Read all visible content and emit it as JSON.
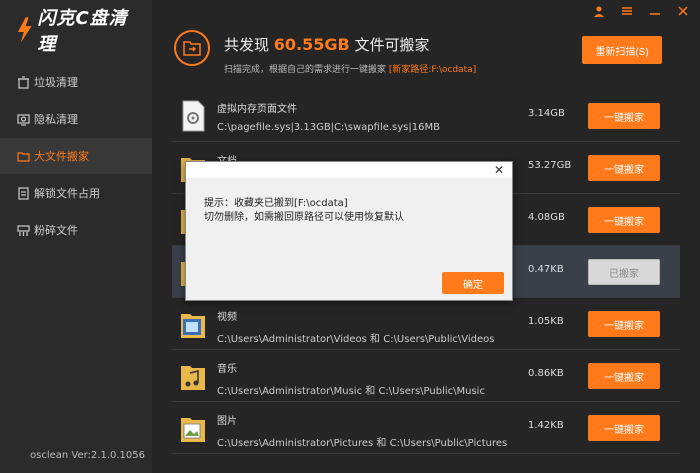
{
  "app": {
    "title": "闪克C盘清理",
    "version": "osclean Ver:2.1.0.1056"
  },
  "topbar": {
    "icons": [
      "user-icon",
      "menu-icon",
      "minimize-icon",
      "close-icon"
    ]
  },
  "sidebar": {
    "items": [
      {
        "label": "垃圾清理",
        "icon": "trash-icon"
      },
      {
        "label": "隐私清理",
        "icon": "privacy-icon"
      },
      {
        "label": "大文件搬家",
        "icon": "folder-icon",
        "active": true
      },
      {
        "label": "解锁文件占用",
        "icon": "unlock-icon"
      },
      {
        "label": "粉碎文件",
        "icon": "shred-icon"
      }
    ]
  },
  "header": {
    "title_prefix": "共发现 ",
    "title_size": "60.55GB",
    "title_suffix": " 文件可搬家",
    "subtitle": "扫描完成，根据自己的需求进行一键搬家 ",
    "new_path": "[新家路径:F:\\ocdata]",
    "rescan_label": "重新扫描(S)"
  },
  "rows": [
    {
      "name": "虚拟内存页面文件",
      "path": "C:\\pagefile.sys|3.13GB|C:\\swapfile.sys|16MB",
      "size": "3.14GB",
      "button": "一键搬家",
      "done": false,
      "icon": "gear-file-icon"
    },
    {
      "name": "文档",
      "path": "",
      "size": "53.27GB",
      "button": "一键搬家",
      "done": false,
      "icon": "documents-folder-icon"
    },
    {
      "name": "",
      "path": "",
      "size": "4.08GB",
      "button": "一键搬家",
      "done": false,
      "icon": "folder-icon"
    },
    {
      "name": "",
      "path": "",
      "size": "0.47KB",
      "button": "已搬家",
      "done": true,
      "icon": "folder-icon"
    },
    {
      "name": "视频",
      "path": "C:\\Users\\Administrator\\Videos 和 C:\\Users\\Public\\Videos",
      "size": "1.05KB",
      "button": "一键搬家",
      "done": false,
      "icon": "videos-folder-icon"
    },
    {
      "name": "音乐",
      "path": "C:\\Users\\Administrator\\Music 和 C:\\Users\\Public\\Music",
      "size": "0.86KB",
      "button": "一键搬家",
      "done": false,
      "icon": "music-folder-icon"
    },
    {
      "name": "图片",
      "path": "C:\\Users\\Administrator\\Pictures 和 C:\\Users\\Public\\Pictures",
      "size": "1.42KB",
      "button": "一键搬家",
      "done": false,
      "icon": "pictures-folder-icon"
    }
  ],
  "dialog": {
    "line1": "提示：收藏夹已搬到[F:\\ocdata]",
    "line2": "切勿删除，如需搬回原路径可以使用恢复默认",
    "ok_label": "确定",
    "close": "✕"
  },
  "colors": {
    "accent": "#ff7a1a",
    "background": "#252525",
    "sidebar": "#2b2b2b"
  }
}
